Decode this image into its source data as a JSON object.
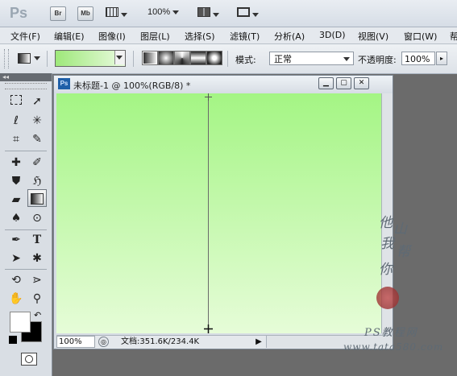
{
  "appbar": {
    "logo": "Ps",
    "bridge_label": "Br",
    "minibridge_label": "Mb",
    "zoom_value": "100%"
  },
  "menu": [
    "文件(F)",
    "编辑(E)",
    "图像(I)",
    "图层(L)",
    "选择(S)",
    "滤镜(T)",
    "分析(A)",
    "3D(D)",
    "视图(V)",
    "窗口(W)",
    "帮"
  ],
  "options": {
    "mode_label": "模式:",
    "mode_value": "正常",
    "opacity_label": "不透明度:",
    "opacity_value": "100%",
    "gradient_colors": [
      "#9ee87a",
      "#eafbe0"
    ]
  },
  "toolbox": {
    "collapse_label": "◂◂"
  },
  "document": {
    "icon_label": "Ps",
    "title": "未标题-1 @ 100%(RGB/8) *",
    "zoom": "100%",
    "doc_info": "文档:351.6K/234.4K",
    "canvas_gradient": [
      "#a4f584",
      "#e6fcd8"
    ]
  },
  "watermark": {
    "handwritten": [
      "他",
      "山",
      "我",
      "帮",
      "你"
    ],
    "site_name": "PS教程网",
    "site_url": "www.tata580.com"
  }
}
